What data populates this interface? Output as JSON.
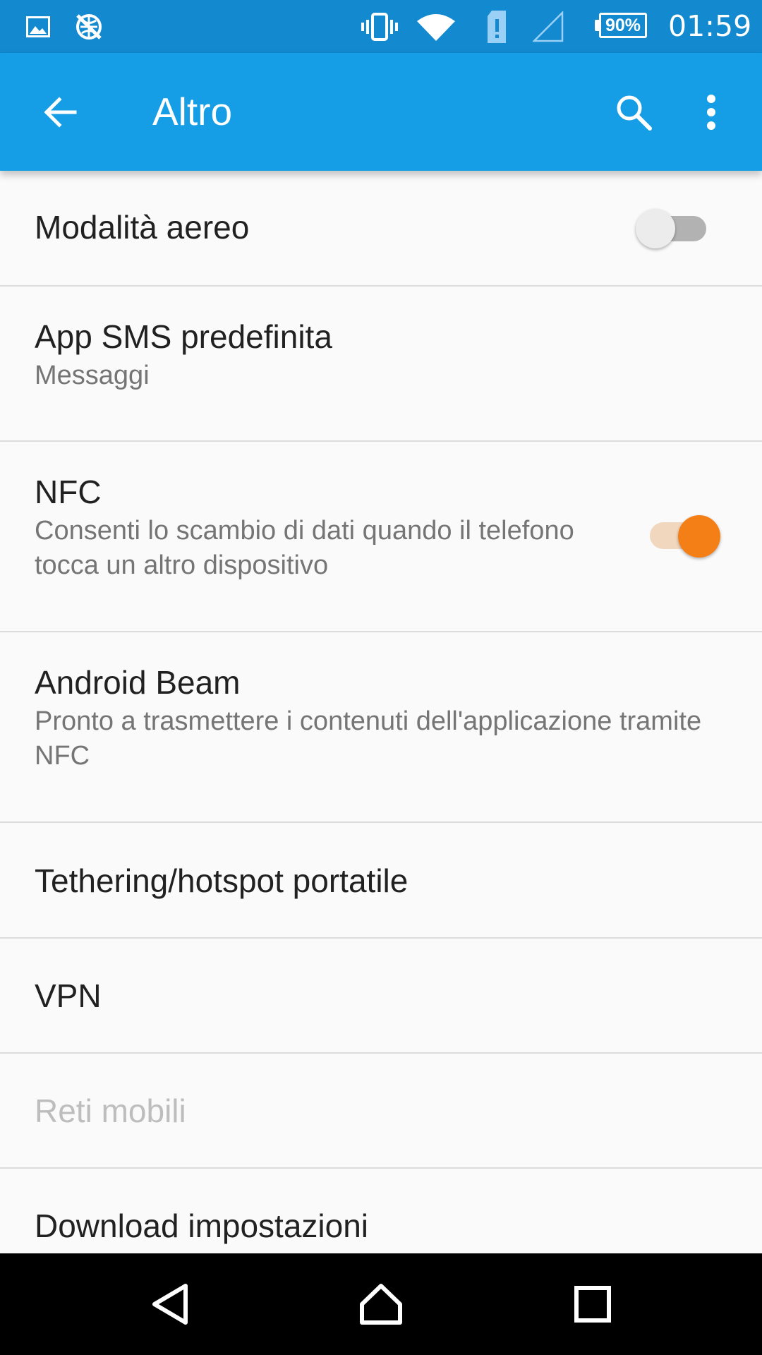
{
  "status_bar": {
    "battery_percent": "90%",
    "time": "01:59",
    "icons": [
      "image-icon",
      "no-sync-icon",
      "vibrate-icon",
      "wifi-icon",
      "sim-alert-icon",
      "no-signal-icon",
      "battery-icon"
    ]
  },
  "app_bar": {
    "title": "Altro",
    "back_icon": "arrow-back-icon",
    "search_icon": "search-icon",
    "more_icon": "more-vert-icon",
    "color": "#159de6"
  },
  "settings": [
    {
      "id": "airplane",
      "title": "Modalità aereo",
      "toggle": true,
      "enabled": false
    },
    {
      "id": "sms",
      "title": "App SMS predefinita",
      "summary": "Messaggi"
    },
    {
      "id": "nfc",
      "title": "NFC",
      "summary": "Consenti lo scambio di dati quando il telefono tocca un altro dispositivo",
      "toggle": true,
      "enabled": true
    },
    {
      "id": "beam",
      "title": "Android Beam",
      "summary": "Pronto a trasmettere i contenuti dell'applicazione tramite NFC"
    },
    {
      "id": "tethering",
      "title": "Tethering/hotspot portatile"
    },
    {
      "id": "vpn",
      "title": "VPN"
    },
    {
      "id": "mobile",
      "title": "Reti mobili",
      "disabled": true
    },
    {
      "id": "download",
      "title": "Download impostazioni"
    }
  ],
  "colors": {
    "accent": "#f57f17",
    "status_bar": "#1389cf",
    "background": "#fafafa"
  },
  "nav_bar": {
    "icons": [
      "back-triangle-icon",
      "home-icon",
      "recents-icon"
    ]
  }
}
